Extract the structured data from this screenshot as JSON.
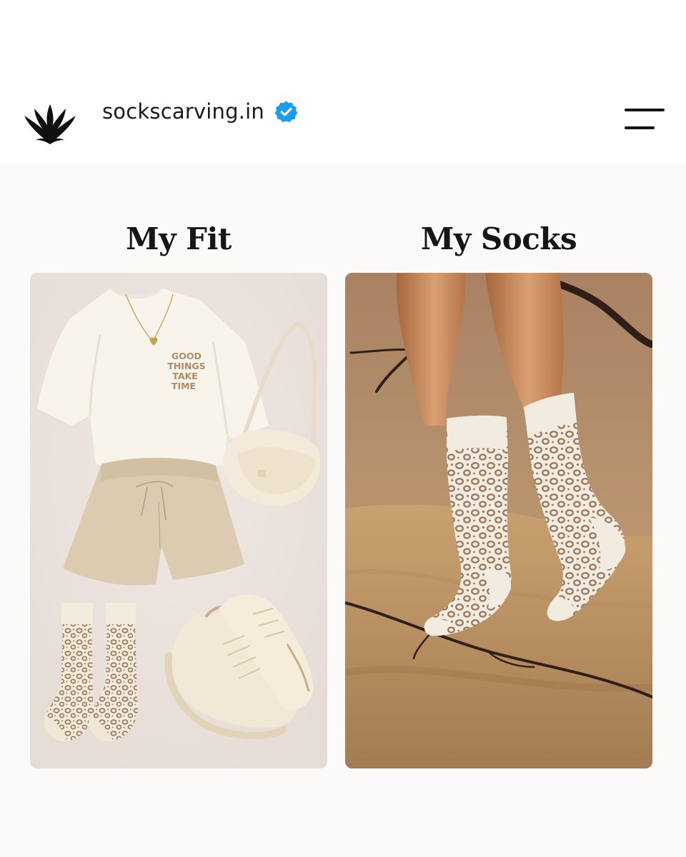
{
  "header": {
    "account_name": "sockscarving.in",
    "logo_icon": "leaf-wings-logo-icon",
    "verified_icon": "verified-badge-icon",
    "menu_icon": "hamburger-menu-icon",
    "verified_color": "#1d9bf0"
  },
  "post": {
    "left_title": "My Fit",
    "right_title": "My Socks",
    "tshirt_text": [
      "GOOD",
      "THINGS",
      "TAKE",
      "TIME"
    ]
  },
  "colors": {
    "left_background": "#ebe3df",
    "right_background": "#b58c66",
    "leopard_spot": "#9b7a5f"
  }
}
